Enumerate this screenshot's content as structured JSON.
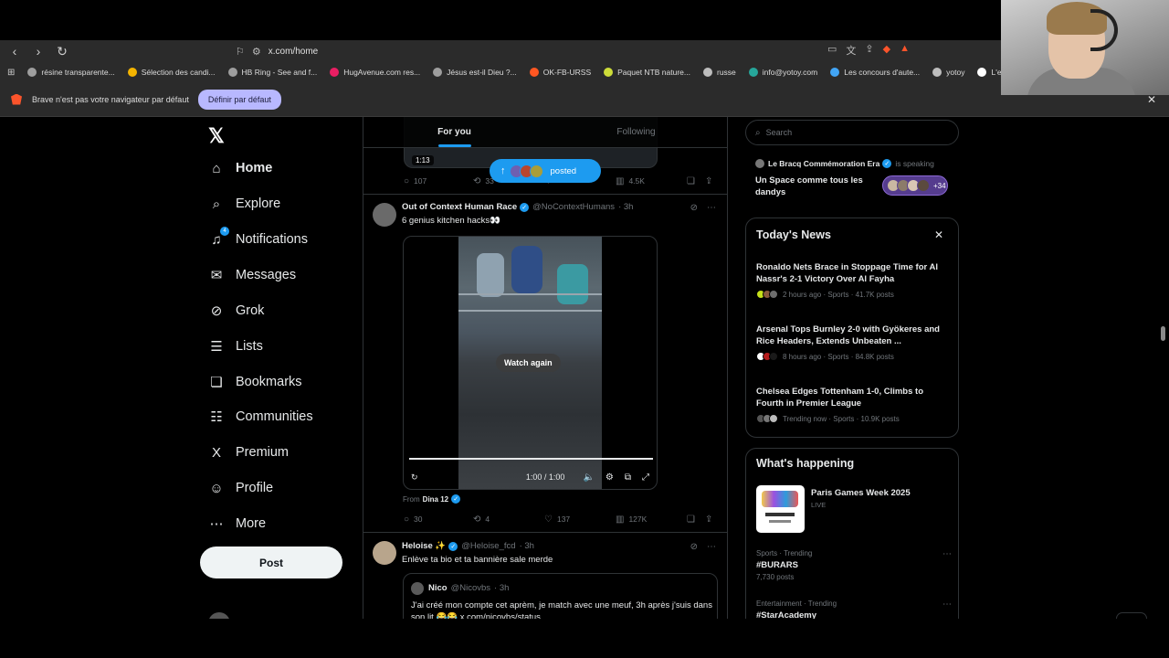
{
  "browser": {
    "url": "x.com/home",
    "bookmarks": [
      {
        "label": "résine transparente...",
        "color": "#9e9e9e"
      },
      {
        "label": "Sélection des candi...",
        "color": "#f4b400"
      },
      {
        "label": "HB Ring - See and f...",
        "color": "#9e9e9e"
      },
      {
        "label": "HugAvenue.com res...",
        "color": "#e91e63"
      },
      {
        "label": "Jésus est-il Dieu ?...",
        "color": "#9e9e9e"
      },
      {
        "label": "OK-FB-URSS",
        "color": "#ff5722"
      },
      {
        "label": "Paquet NTB nature...",
        "color": "#cddc39"
      },
      {
        "label": "russe",
        "color": "#bdbdbd"
      },
      {
        "label": "info@yotoy.com",
        "color": "#26a69a"
      },
      {
        "label": "Les concours d'aute...",
        "color": "#42a5f5"
      },
      {
        "label": "yotoy",
        "color": "#bdbdbd"
      },
      {
        "label": "L'esquif fantôme eB...",
        "color": "#ffffff"
      }
    ],
    "infobar": {
      "message": "Brave n'est pas votre navigateur par défaut",
      "button": "Définir par défaut"
    }
  },
  "nav": {
    "items": [
      {
        "name": "home",
        "label": "Home",
        "icon": "⌂",
        "active": true
      },
      {
        "name": "explore",
        "label": "Explore",
        "icon": "⌕"
      },
      {
        "name": "notifications",
        "label": "Notifications",
        "icon": "♫",
        "badge": "4"
      },
      {
        "name": "messages",
        "label": "Messages",
        "icon": "✉"
      },
      {
        "name": "grok",
        "label": "Grok",
        "icon": "⊘"
      },
      {
        "name": "lists",
        "label": "Lists",
        "icon": "☰"
      },
      {
        "name": "bookmarks",
        "label": "Bookmarks",
        "icon": "❏"
      },
      {
        "name": "communities",
        "label": "Communities",
        "icon": "☷"
      },
      {
        "name": "premium",
        "label": "Premium",
        "icon": "X"
      },
      {
        "name": "profile",
        "label": "Profile",
        "icon": "☺"
      },
      {
        "name": "more",
        "label": "More",
        "icon": "⋯"
      }
    ],
    "post_label": "Post",
    "notif_badge": "4"
  },
  "timeline": {
    "tabs": {
      "for_you": "For you",
      "following": "Following"
    },
    "prev_tweet": {
      "duration": "1:13",
      "replies": "107",
      "reposts": "33",
      "views": "4.5K"
    },
    "posted_pill": "posted",
    "tweet1": {
      "name": "Out of Context Human Race",
      "handle": "@NoContextHumans",
      "time": "· 3h",
      "text": "6 genius kitchen hacks👀",
      "watch_again": "Watch again",
      "video_time": "1:00 / 1:00",
      "from_label": "From",
      "from_name": "Dina 12",
      "replies": "30",
      "reposts": "4",
      "likes": "137",
      "views": "127K"
    },
    "tweet2": {
      "name": "Heloise ✨",
      "handle": "@Heloise_fcd",
      "time": "· 3h",
      "text": "Enlève ta bio et ta bannière sale merde",
      "quote": {
        "name": "Nico",
        "handle": "@Nicovbs",
        "time": "· 3h",
        "text": "J'ai créé mon compte cet aprèm, je match avec une meuf, 3h après j'suis dans son lit 😂😂 x.com/nicovbs/status..."
      }
    }
  },
  "sidebar": {
    "search_placeholder": "Search",
    "space": {
      "host": "Le Bracq Commémoration Era",
      "status": "is speaking",
      "title": "Un Space comme tous les dandys",
      "listeners": "+34"
    },
    "news": {
      "title": "Today's News",
      "items": [
        {
          "headline": "Ronaldo Nets Brace in Stoppage Time for Al Nassr's 2-1 Victory Over Al Fayha",
          "meta": "2 hours ago · Sports · 41.7K posts"
        },
        {
          "headline": "Arsenal Tops Burnley 2-0 with Gyökeres and Rice Headers, Extends Unbeaten ...",
          "meta": "8 hours ago · Sports · 84.8K posts"
        },
        {
          "headline": "Chelsea Edges Tottenham 1-0, Climbs to Fourth in Premier League",
          "meta": "Trending now · Sports · 10.9K posts"
        }
      ]
    },
    "happening": {
      "title": "What's happening",
      "event": {
        "title": "Paris Games Week 2025",
        "sub": "LIVE"
      },
      "trends": [
        {
          "category": "Sports · Trending",
          "name": "#BURARS",
          "count": "7,730 posts"
        },
        {
          "category": "Entertainment · Trending",
          "name": "#StarAcademy",
          "count": ""
        }
      ]
    }
  },
  "colors": {
    "accent": "#1d9bf0",
    "background": "#000000",
    "border": "#2f3336",
    "muted": "#71767b"
  }
}
